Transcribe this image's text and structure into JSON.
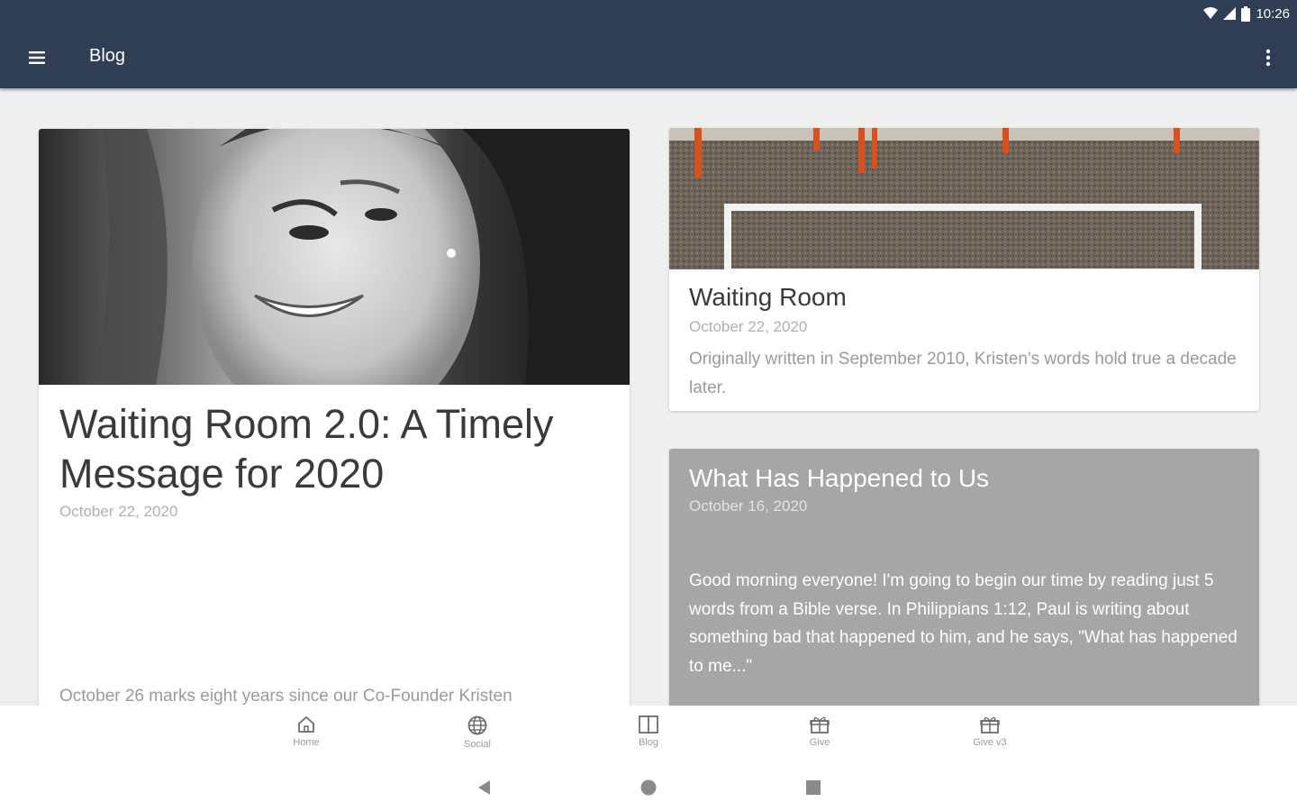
{
  "status_bar": {
    "time": "10:26",
    "icons": [
      "wifi-icon",
      "signal-icon",
      "battery-icon"
    ]
  },
  "app_bar": {
    "title": "Blog",
    "menu_icon": "hamburger-menu-icon",
    "overflow_icon": "more-vert-icon",
    "color": "#2f3e55"
  },
  "posts": [
    {
      "title": "Waiting Room 2.0: A Timely Message for 2020",
      "date": "October 22, 2020",
      "excerpt": "October 26 marks eight years since our Co-Founder Kristen"
    },
    {
      "title": "Waiting Room",
      "date": "October 22, 2020",
      "excerpt": "Originally written in September 2010, Kristen's words hold true a decade later."
    },
    {
      "title": "What Has Happened to Us",
      "date": "October 16, 2020",
      "excerpt": "Good morning everyone!  I'm going to begin our time by reading just 5 words from a Bible verse.  In Philippians 1:12, Paul is writing about something bad that happened to him, and he says, \"What has happened to me...\""
    }
  ],
  "bottom_nav": [
    {
      "label": "Home",
      "icon": "home-icon"
    },
    {
      "label": "Social",
      "icon": "globe-icon"
    },
    {
      "label": "Blog",
      "icon": "book-icon",
      "selected": true
    },
    {
      "label": "Give",
      "icon": "gift-icon"
    },
    {
      "label": "Give v3",
      "icon": "gift-icon"
    }
  ],
  "system_nav": [
    "back-icon",
    "home-circle-icon",
    "recents-square-icon"
  ]
}
